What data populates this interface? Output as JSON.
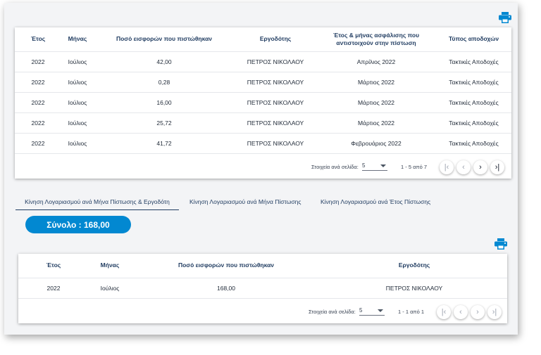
{
  "colors": {
    "accent": "#0288d1",
    "header_text": "#1e3a5f"
  },
  "print_icon": "printer-icon",
  "table1": {
    "headers": [
      "Έτος",
      "Μήνας",
      "Ποσό εισφορών που πιστώθηκαν",
      "Εργοδότης",
      "Έτος & μήνας ασφάλισης που αντιστοιχούν στην πίστωση",
      "Τύπος αποδοχών"
    ],
    "rows": [
      [
        "2022",
        "Ιούλιος",
        "42,00",
        "ΠΕΤΡΟΣ ΝΙΚΟΛΑΟΥ",
        "Απρίλιος 2022",
        "Τακτικές Αποδοχές"
      ],
      [
        "2022",
        "Ιούλιος",
        "0,28",
        "ΠΕΤΡΟΣ ΝΙΚΟΛΑΟΥ",
        "Μάρτιος 2022",
        "Τακτικές Αποδοχές"
      ],
      [
        "2022",
        "Ιούλιος",
        "16,00",
        "ΠΕΤΡΟΣ ΝΙΚΟΛΑΟΥ",
        "Μάρτιος 2022",
        "Τακτικές Αποδοχές"
      ],
      [
        "2022",
        "Ιούλιος",
        "25,72",
        "ΠΕΤΡΟΣ ΝΙΚΟΛΑΟΥ",
        "Μάρτιος 2022",
        "Τακτικές Αποδοχές"
      ],
      [
        "2022",
        "Ιούλιος",
        "41,72",
        "ΠΕΤΡΟΣ ΝΙΚΟΛΑΟΥ",
        "Φεβρουάριος 2022",
        "Τακτικές Αποδοχές"
      ]
    ],
    "paginator": {
      "per_page_label": "Στοιχεία ανά σελίδα:",
      "per_page_value": "5",
      "range": "1 - 5 από 7"
    }
  },
  "tabs": [
    "Κίνηση Λογαριασμού ανά Μήνα Πίστωσης & Εργοδότη",
    "Κίνηση Λογαριασμού ανά Μήνα Πίστωσης",
    "Κίνηση Λογαριασμού ανά Έτος Πίστωσης"
  ],
  "total_label": "Σύνολο : 168,00",
  "table2": {
    "headers": [
      "Έτος",
      "Μήνας",
      "Ποσό εισφορών που πιστώθηκαν",
      "Εργοδότης"
    ],
    "rows": [
      [
        "2022",
        "Ιούλιος",
        "168,00",
        "ΠΕΤΡΟΣ ΝΙΚΟΛΑΟΥ"
      ]
    ],
    "paginator": {
      "per_page_label": "Στοιχεία ανά σελίδα:",
      "per_page_value": "5",
      "range": "1 - 1 από 1"
    }
  },
  "nav_icons": [
    "first-page-icon",
    "previous-page-icon",
    "next-page-icon",
    "last-page-icon"
  ]
}
